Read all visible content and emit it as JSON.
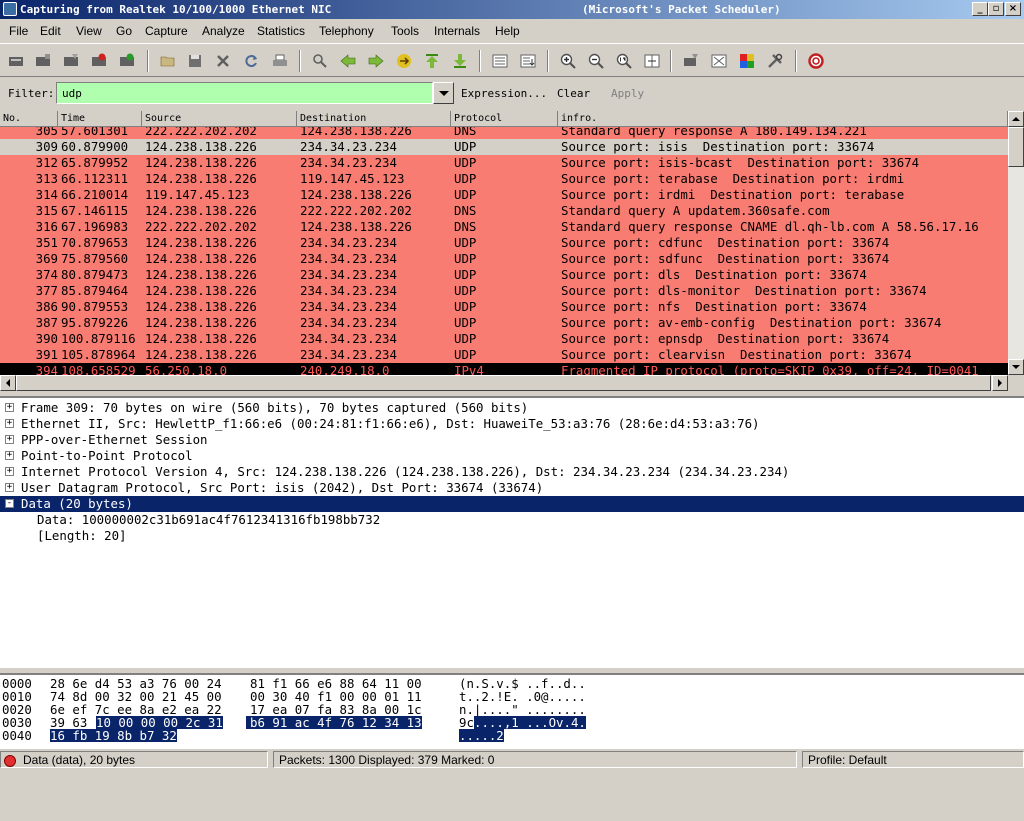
{
  "window": {
    "title": "Capturing from Realtek 10/100/1000 Ethernet NIC",
    "title_suffix": "(Microsoft's Packet Scheduler)",
    "minimize": "_",
    "maximize": "▫",
    "close": "×"
  },
  "menu": [
    "File",
    "Edit",
    "View",
    "Go",
    "Capture",
    "Analyze",
    "Statistics",
    "Telephony",
    "Tools",
    "Internals",
    "Help"
  ],
  "toolbar": {
    "icons": [
      "interface-list-icon",
      "capture-options-icon",
      "start-capture-icon",
      "stop-capture-icon",
      "restart-capture-icon",
      "open-file-icon",
      "save-file-icon",
      "close-file-icon",
      "reload-icon",
      "print-icon",
      "find-packet-icon",
      "go-back-icon",
      "go-forward-icon",
      "go-to-packet-icon",
      "go-first-icon",
      "go-last-icon",
      "colorize-icon",
      "auto-scroll-icon",
      "zoom-in-icon",
      "zoom-out-icon",
      "normal-size-icon",
      "resize-columns-icon",
      "capture-filters-icon",
      "display-filters-icon",
      "coloring-rules-icon",
      "preferences-icon",
      "help-icon"
    ]
  },
  "filter": {
    "label": "Filter:",
    "value": "udp",
    "expression": "Expression...",
    "clear": "Clear",
    "apply": "Apply"
  },
  "columns": [
    "No.",
    "Time",
    "Source",
    "Destination",
    "Protocol",
    "infro."
  ],
  "packets": [
    {
      "no": "305",
      "time": "57.601301",
      "src": "222.222.202.202",
      "dst": "124.238.138.226",
      "proto": "DNS",
      "info": "Standard query response A 180.149.134.221",
      "style": "red"
    },
    {
      "no": "309",
      "time": "60.879900",
      "src": "124.238.138.226",
      "dst": "234.34.23.234",
      "proto": "UDP",
      "info": "Source port: isis  Destination port: 33674",
      "style": "selected"
    },
    {
      "no": "312",
      "time": "65.879952",
      "src": "124.238.138.226",
      "dst": "234.34.23.234",
      "proto": "UDP",
      "info": "Source port: isis-bcast  Destination port: 33674",
      "style": "red"
    },
    {
      "no": "313",
      "time": "66.112311",
      "src": "124.238.138.226",
      "dst": "119.147.45.123",
      "proto": "UDP",
      "info": "Source port: terabase  Destination port: irdmi",
      "style": "red"
    },
    {
      "no": "314",
      "time": "66.210014",
      "src": "119.147.45.123",
      "dst": "124.238.138.226",
      "proto": "UDP",
      "info": "Source port: irdmi  Destination port: terabase",
      "style": "red"
    },
    {
      "no": "315",
      "time": "67.146115",
      "src": "124.238.138.226",
      "dst": "222.222.202.202",
      "proto": "DNS",
      "info": "Standard query A updatem.360safe.com",
      "style": "red"
    },
    {
      "no": "316",
      "time": "67.196983",
      "src": "222.222.202.202",
      "dst": "124.238.138.226",
      "proto": "DNS",
      "info": "Standard query response CNAME dl.qh-lb.com A 58.56.17.16",
      "style": "red"
    },
    {
      "no": "351",
      "time": "70.879653",
      "src": "124.238.138.226",
      "dst": "234.34.23.234",
      "proto": "UDP",
      "info": "Source port: cdfunc  Destination port: 33674",
      "style": "red"
    },
    {
      "no": "369",
      "time": "75.879560",
      "src": "124.238.138.226",
      "dst": "234.34.23.234",
      "proto": "UDP",
      "info": "Source port: sdfunc  Destination port: 33674",
      "style": "red"
    },
    {
      "no": "374",
      "time": "80.879473",
      "src": "124.238.138.226",
      "dst": "234.34.23.234",
      "proto": "UDP",
      "info": "Source port: dls  Destination port: 33674",
      "style": "red"
    },
    {
      "no": "377",
      "time": "85.879464",
      "src": "124.238.138.226",
      "dst": "234.34.23.234",
      "proto": "UDP",
      "info": "Source port: dls-monitor  Destination port: 33674",
      "style": "red"
    },
    {
      "no": "386",
      "time": "90.879553",
      "src": "124.238.138.226",
      "dst": "234.34.23.234",
      "proto": "UDP",
      "info": "Source port: nfs  Destination port: 33674",
      "style": "red"
    },
    {
      "no": "387",
      "time": "95.879226",
      "src": "124.238.138.226",
      "dst": "234.34.23.234",
      "proto": "UDP",
      "info": "Source port: av-emb-config  Destination port: 33674",
      "style": "red"
    },
    {
      "no": "390",
      "time": "100.879116",
      "src": "124.238.138.226",
      "dst": "234.34.23.234",
      "proto": "UDP",
      "info": "Source port: epnsdp  Destination port: 33674",
      "style": "red"
    },
    {
      "no": "391",
      "time": "105.878964",
      "src": "124.238.138.226",
      "dst": "234.34.23.234",
      "proto": "UDP",
      "info": "Source port: clearvisn  Destination port: 33674",
      "style": "red"
    },
    {
      "no": "394",
      "time": "108.658529",
      "src": "56.250.18.0",
      "dst": "240.249.18.0",
      "proto": "IPv4",
      "info": "Fragmented IP protocol (proto=SKIP 0x39, off=24, ID=0041",
      "style": "black"
    }
  ],
  "row_colors": {
    "red": "#f87c72",
    "selected": "#d4d0c8",
    "black": "#000000",
    "black_text": "#ff5a5a"
  },
  "details": [
    {
      "text": "Frame 309: 70 bytes on wire (560 bits), 70 bytes captured (560 bits)",
      "expander": "+",
      "indent": 0
    },
    {
      "text": "Ethernet II, Src: HewlettP_f1:66:e6 (00:24:81:f1:66:e6), Dst: HuaweiTe_53:a3:76 (28:6e:d4:53:a3:76)",
      "expander": "+",
      "indent": 0
    },
    {
      "text": "PPP-over-Ethernet Session",
      "expander": "+",
      "indent": 0
    },
    {
      "text": "Point-to-Point Protocol",
      "expander": "+",
      "indent": 0
    },
    {
      "text": "Internet Protocol Version 4, Src: 124.238.138.226 (124.238.138.226), Dst: 234.34.23.234 (234.34.23.234)",
      "expander": "+",
      "indent": 0
    },
    {
      "text": "User Datagram Protocol, Src Port: isis (2042), Dst Port: 33674 (33674)",
      "expander": "+",
      "indent": 0
    },
    {
      "text": "Data (20 bytes)",
      "expander": "-",
      "indent": 0,
      "selected": true
    },
    {
      "text": "Data: 100000002c31b691ac4f7612341316fb198bb732",
      "expander": "",
      "indent": 1
    },
    {
      "text": "[Length: 20]",
      "expander": "",
      "indent": 1
    }
  ],
  "hex": [
    {
      "offset": "0000",
      "bytes1": "28 6e d4 53 a3 76 00 24",
      "bytes2": "81 f1 66 e6 88 64 11 00",
      "ascii": "(n.S.v.$ ..f..d.."
    },
    {
      "offset": "0010",
      "bytes1": "74 8d 00 32 00 21 45 00",
      "bytes2": "00 30 40 f1 00 00 01 11",
      "ascii": "t..2.!E. .0@....."
    },
    {
      "offset": "0020",
      "bytes1": "6e ef 7c ee 8a e2 ea 22",
      "bytes2": "17 ea 07 fa 83 8a 00 1c",
      "ascii": "n.|....\" ........"
    },
    {
      "offset": "0030",
      "bytes1_plain": "39 63 ",
      "bytes1_hl": "10 00 00 00 2c 31",
      "bytes2_hl": "b6 91 ac 4f 76 12 34 13",
      "ascii_plain": "9c",
      "ascii_hl": "....,1 ...Ov.4."
    },
    {
      "offset": "0040",
      "bytes1_hl": "16 fb 19 8b b7 32",
      "ascii_hl": ".....2"
    }
  ],
  "status": {
    "field": "Data (data), 20 bytes",
    "packets": "Packets: 1300 Displayed: 379 Marked: 0",
    "profile": "Profile: Default"
  }
}
